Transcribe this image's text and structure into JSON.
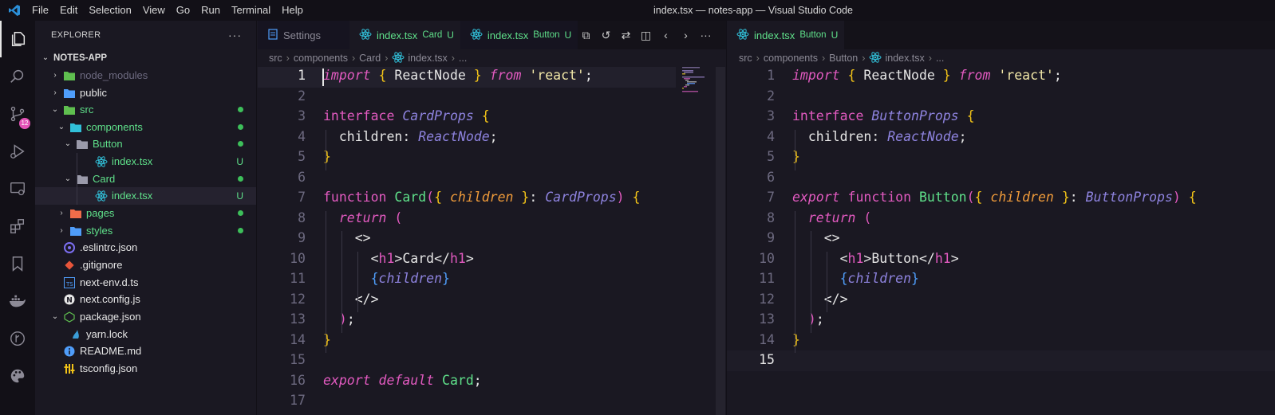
{
  "window": {
    "title": "index.tsx — notes-app — Visual Studio Code"
  },
  "menu": [
    "File",
    "Edit",
    "Selection",
    "View",
    "Go",
    "Run",
    "Terminal",
    "Help"
  ],
  "activity_bar": {
    "items": [
      "explorer-icon",
      "search-icon",
      "source-control-icon",
      "run-debug-icon",
      "remote-explorer-icon",
      "extensions-icon",
      "bookmarks-icon",
      "docker-icon",
      "git-graph-icon",
      "palette-icon"
    ],
    "source_control_badge": "12"
  },
  "sidebar": {
    "title": "EXPLORER",
    "more": "···",
    "root": "NOTES-APP",
    "items": [
      {
        "label": "node_modules",
        "color": "#6d6a80",
        "chev": "›",
        "status": ""
      },
      {
        "label": "public",
        "color": "#e6e6e6",
        "chev": "›",
        "status": ""
      },
      {
        "label": "src",
        "color": "#5fe08a",
        "chev": "⌄",
        "status": "dot"
      },
      {
        "label": "components",
        "color": "#5fe08a",
        "chev": "⌄",
        "status": "dot"
      },
      {
        "label": "Button",
        "color": "#5fe08a",
        "chev": "⌄",
        "status": "dot"
      },
      {
        "label": "index.tsx",
        "color": "#5fe08a",
        "chev": "",
        "status": "U"
      },
      {
        "label": "Card",
        "color": "#5fe08a",
        "chev": "⌄",
        "status": "dot"
      },
      {
        "label": "index.tsx",
        "color": "#5fe08a",
        "chev": "",
        "status": "U"
      },
      {
        "label": "pages",
        "color": "#5fe08a",
        "chev": "›",
        "status": "dot"
      },
      {
        "label": "styles",
        "color": "#5fe08a",
        "chev": "›",
        "status": "dot"
      },
      {
        "label": ".eslintrc.json",
        "color": "#e6e6e6",
        "chev": "",
        "status": ""
      },
      {
        "label": ".gitignore",
        "color": "#e6e6e6",
        "chev": "",
        "status": ""
      },
      {
        "label": "next-env.d.ts",
        "color": "#e6e6e6",
        "chev": "",
        "status": ""
      },
      {
        "label": "next.config.js",
        "color": "#e6e6e6",
        "chev": "",
        "status": ""
      },
      {
        "label": "package.json",
        "color": "#e6e6e6",
        "chev": "⌄",
        "status": ""
      },
      {
        "label": "yarn.lock",
        "color": "#e6e6e6",
        "chev": "",
        "status": ""
      },
      {
        "label": "README.md",
        "color": "#e6e6e6",
        "chev": "",
        "status": ""
      },
      {
        "label": "tsconfig.json",
        "color": "#e6e6e6",
        "chev": "",
        "status": ""
      }
    ]
  },
  "left_group": {
    "tabs": [
      {
        "label": "Settings",
        "sub": "",
        "u": ""
      },
      {
        "label": "index.tsx",
        "sub": "Card",
        "u": "U"
      },
      {
        "label": "index.tsx",
        "sub": "Button",
        "u": "U"
      }
    ],
    "breadcrumb": [
      "src",
      "components",
      "Card",
      "index.tsx",
      "..."
    ],
    "line_numbers": [
      "1",
      "2",
      "3",
      "4",
      "5",
      "6",
      "7",
      "8",
      "9",
      "10",
      "11",
      "12",
      "13",
      "14",
      "15",
      "16",
      "17"
    ]
  },
  "right_group": {
    "tabs": [
      {
        "label": "index.tsx",
        "sub": "Button",
        "u": "U"
      }
    ],
    "breadcrumb": [
      "src",
      "components",
      "Button",
      "index.tsx",
      "..."
    ],
    "line_numbers": [
      "1",
      "2",
      "3",
      "4",
      "5",
      "6",
      "7",
      "8",
      "9",
      "10",
      "11",
      "12",
      "13",
      "14",
      "15"
    ]
  },
  "colors": {
    "keyword": "#e25ac0",
    "type": "#8e83df",
    "brace": "#f2c318",
    "function": "#5fe08a",
    "param": "#f09b3a",
    "jsx_brace": "#4f9dfa",
    "git_untracked": "#5fe08a"
  },
  "code_left": [
    [
      [
        "k-imp",
        "import"
      ],
      [
        "",
        " "
      ],
      [
        "k-brace",
        "{"
      ],
      [
        "",
        " ReactNode "
      ],
      [
        "k-brace",
        "}"
      ],
      [
        "",
        " "
      ],
      [
        "k-imp",
        "from"
      ],
      [
        "",
        " "
      ],
      [
        "k-str",
        "'react'"
      ],
      [
        "",
        ";"
      ]
    ],
    [],
    [
      [
        "k-kw",
        "interface"
      ],
      [
        "",
        " "
      ],
      [
        "k-ty",
        "CardProps"
      ],
      [
        "",
        " "
      ],
      [
        "k-brace",
        "{"
      ]
    ],
    [
      [
        "",
        "  children: "
      ],
      [
        "k-ty",
        "ReactNode"
      ],
      [
        "",
        ";"
      ]
    ],
    [
      [
        "k-brace",
        "}"
      ]
    ],
    [],
    [
      [
        "k-kw",
        "function"
      ],
      [
        "",
        " "
      ],
      [
        "k-fn",
        "Card"
      ],
      [
        "k-kw",
        "("
      ],
      [
        "k-brace",
        "{"
      ],
      [
        "",
        " "
      ],
      [
        "k-param",
        "children"
      ],
      [
        "",
        " "
      ],
      [
        "k-brace",
        "}"
      ],
      [
        "",
        ": "
      ],
      [
        "k-ty",
        "CardProps"
      ],
      [
        "k-kw",
        ")"
      ],
      [
        "",
        " "
      ],
      [
        "k-brace",
        "{"
      ]
    ],
    [
      [
        "",
        "  "
      ],
      [
        "k-imp",
        "return"
      ],
      [
        "",
        " "
      ],
      [
        "k-kw",
        "("
      ]
    ],
    [
      [
        "",
        "    <>"
      ]
    ],
    [
      [
        "",
        "      <"
      ],
      [
        "k-tag",
        "h1"
      ],
      [
        "",
        ">Card</"
      ],
      [
        "k-tag",
        "h1"
      ],
      [
        "",
        ">"
      ]
    ],
    [
      [
        "",
        "      "
      ],
      [
        "k-jsx",
        "{"
      ],
      [
        "k-child",
        "children"
      ],
      [
        "k-jsx",
        "}"
      ]
    ],
    [
      [
        "",
        "    </>"
      ]
    ],
    [
      [
        "",
        "  "
      ],
      [
        "k-kw",
        ")"
      ],
      [
        "",
        ";"
      ]
    ],
    [
      [
        "k-brace",
        "}"
      ]
    ],
    [],
    [
      [
        "k-imp",
        "export"
      ],
      [
        "",
        " "
      ],
      [
        "k-imp",
        "default"
      ],
      [
        "",
        " "
      ],
      [
        "k-fn",
        "Card"
      ],
      [
        "",
        ";"
      ]
    ],
    []
  ],
  "code_right": [
    [
      [
        "k-imp",
        "import"
      ],
      [
        "",
        " "
      ],
      [
        "k-brace",
        "{"
      ],
      [
        "",
        " ReactNode "
      ],
      [
        "k-brace",
        "}"
      ],
      [
        "",
        " "
      ],
      [
        "k-imp",
        "from"
      ],
      [
        "",
        " "
      ],
      [
        "k-str",
        "'react'"
      ],
      [
        "",
        ";"
      ]
    ],
    [],
    [
      [
        "k-kw",
        "interface"
      ],
      [
        "",
        " "
      ],
      [
        "k-ty",
        "ButtonProps"
      ],
      [
        "",
        " "
      ],
      [
        "k-brace",
        "{"
      ]
    ],
    [
      [
        "",
        "  children: "
      ],
      [
        "k-ty",
        "ReactNode"
      ],
      [
        "",
        ";"
      ]
    ],
    [
      [
        "k-brace",
        "}"
      ]
    ],
    [],
    [
      [
        "k-imp",
        "export"
      ],
      [
        "",
        " "
      ],
      [
        "k-kw",
        "function"
      ],
      [
        "",
        " "
      ],
      [
        "k-fn",
        "Button"
      ],
      [
        "k-kw",
        "("
      ],
      [
        "k-brace",
        "{"
      ],
      [
        "",
        " "
      ],
      [
        "k-param",
        "children"
      ],
      [
        "",
        " "
      ],
      [
        "k-brace",
        "}"
      ],
      [
        "",
        ": "
      ],
      [
        "k-ty",
        "ButtonProps"
      ],
      [
        "k-kw",
        ")"
      ],
      [
        "",
        " "
      ],
      [
        "k-brace",
        "{"
      ]
    ],
    [
      [
        "",
        "  "
      ],
      [
        "k-imp",
        "return"
      ],
      [
        "",
        " "
      ],
      [
        "k-kw",
        "("
      ]
    ],
    [
      [
        "",
        "    <>"
      ]
    ],
    [
      [
        "",
        "      <"
      ],
      [
        "k-tag",
        "h1"
      ],
      [
        "",
        ">Button</"
      ],
      [
        "k-tag",
        "h1"
      ],
      [
        "",
        ">"
      ]
    ],
    [
      [
        "",
        "      "
      ],
      [
        "k-jsx",
        "{"
      ],
      [
        "k-child",
        "children"
      ],
      [
        "k-jsx",
        "}"
      ]
    ],
    [
      [
        "",
        "    </>"
      ]
    ],
    [
      [
        "",
        "  "
      ],
      [
        "k-kw",
        ")"
      ],
      [
        "",
        ";"
      ]
    ],
    [
      [
        "k-brace",
        "}"
      ]
    ],
    []
  ]
}
